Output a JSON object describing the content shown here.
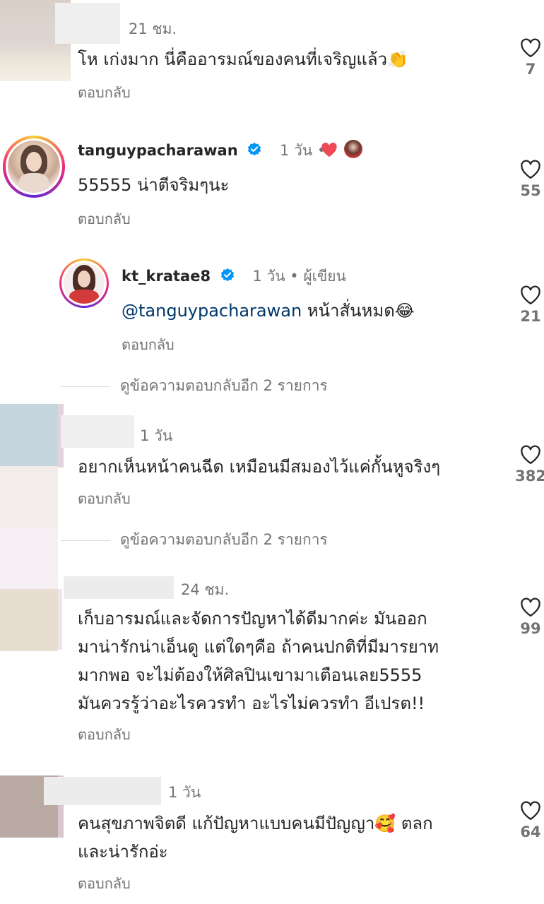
{
  "comments": [
    {
      "time": "21 ชม.",
      "text": "โห เก่งมาก นี่คืออารมณ์ของคนที่เจริญแล้ว👏",
      "reply_label": "ตอบกลับ",
      "likes": "7"
    },
    {
      "username": "tanguypacharawan",
      "time": "1 วัน •",
      "text": "55555 น่าตีจริมๆนะ",
      "reply_label": "ตอบกลับ",
      "likes": "55",
      "author_liked": true
    },
    {
      "username": "kt_kratae8",
      "time": "1 วัน • ผู้เขียน",
      "mention": "@tanguypacharawan",
      "text": "หน้าสั่นหมด😂",
      "reply_label": "ตอบกลับ",
      "likes": "21"
    },
    {
      "time": "1 วัน",
      "text": "อยากเห็นหน้าคนฉีด เหมือนมีสมองไว้แค่กั้นหูจริงๆ",
      "reply_label": "ตอบกลับ",
      "likes": "382"
    },
    {
      "time": "24 ชม.",
      "text_lines": [
        "เก็บอารมณ์และจัดการปัญหาได้ดีมากค่ะ มันออก",
        "มาน่ารักน่าเอ็นดู แต่ใดๆคือ ถ้าคนปกติที่มีมารยาท",
        "มากพอ จะไม่ต้องให้ศิลปินเขามาเตือนเลย5555",
        "มันควรรู้ว่าอะไรควรทำ อะไรไม่ควรทำ อีเปรต!!"
      ],
      "reply_label": "ตอบกลับ",
      "likes": "99"
    },
    {
      "time": "1 วัน",
      "text_lines": [
        "คนสุขภาพจิตดี แก้ปัญหาแบบคนมีปัญญา🥰 ตลก",
        "และน่ารักอ่ะ"
      ],
      "reply_label": "ตอบกลับ",
      "likes": "64"
    }
  ],
  "view_more_1": "ดูข้อความตอบกลับอีก 2 รายการ",
  "view_more_2": "ดูข้อความตอบกลับอีก 2 รายการ",
  "colors": {
    "text": "#262626",
    "muted": "#737373",
    "mention": "#00376b",
    "verified": "#0095f6",
    "heart_red": "#ed4956"
  },
  "icons": [
    "heart-outline-icon",
    "verified-badge-icon",
    "red-heart-icon"
  ]
}
